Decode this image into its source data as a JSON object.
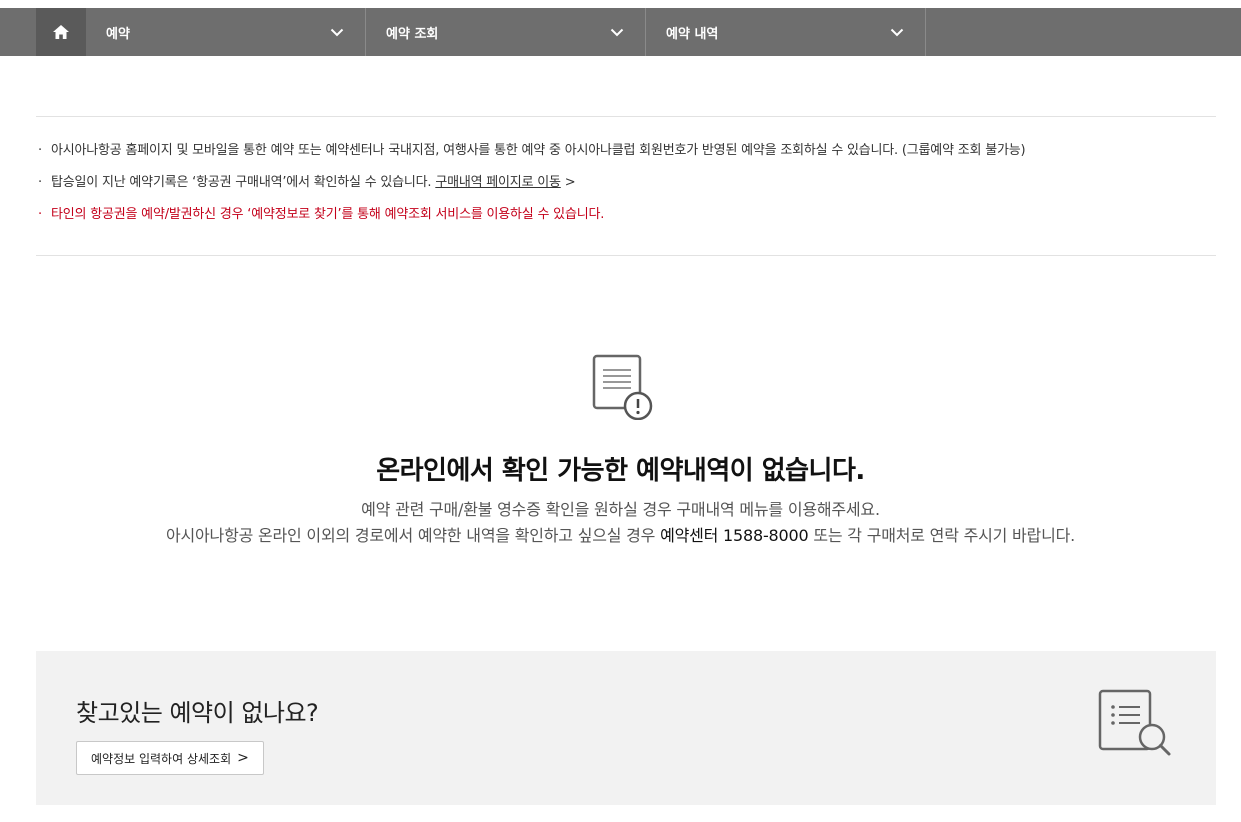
{
  "nav": {
    "home_icon": "home-icon",
    "items": [
      {
        "label": "예약"
      },
      {
        "label": "예약 조회"
      },
      {
        "label": "예약 내역"
      }
    ]
  },
  "notice": {
    "line1": "아시아나항공 홈페이지 및 모바일을 통한 예약 또는 예약센터나 국내지점, 여행사를 통한 예약 중 아시아나클럽 회원번호가 반영된 예약을 조회하실 수 있습니다. (그룹예약 조회 불가능)",
    "line2": "탑승일이 지난 예약기록은 ‘항공권 구매내역’에서 확인하실 수 있습니다.",
    "line2_link": "구매내역 페이지로 이동",
    "line2_arrow": ">",
    "line3": "타인의 항공권을 예약/발권하신 경우 ‘예약정보로 찾기’를 통해 예약조회 서비스를 이용하실 수 있습니다.",
    "line3_color": "#c4001a"
  },
  "empty": {
    "icon": "document-alert-icon",
    "title": "온라인에서 확인 가능한 예약내역이 없습니다.",
    "desc1": "예약 관련 구매/환불 영수증 확인을 원하실 경우 구매내역 메뉴를 이용해주세요.",
    "desc2_pre": "아시아나항공 온라인 이외의 경로에서 예약한 내역을 확인하고 싶으실 경우 ",
    "desc2_strong": "예약센터 1588-8000",
    "desc2_post": " 또는 각 구매처로 연락 주시기 바랍니다."
  },
  "find": {
    "title": "찾고있는 예약이 없나요?",
    "button_label": "예약정보 입력하여 상세조회",
    "button_arrow": ">",
    "icon": "list-search-icon"
  }
}
